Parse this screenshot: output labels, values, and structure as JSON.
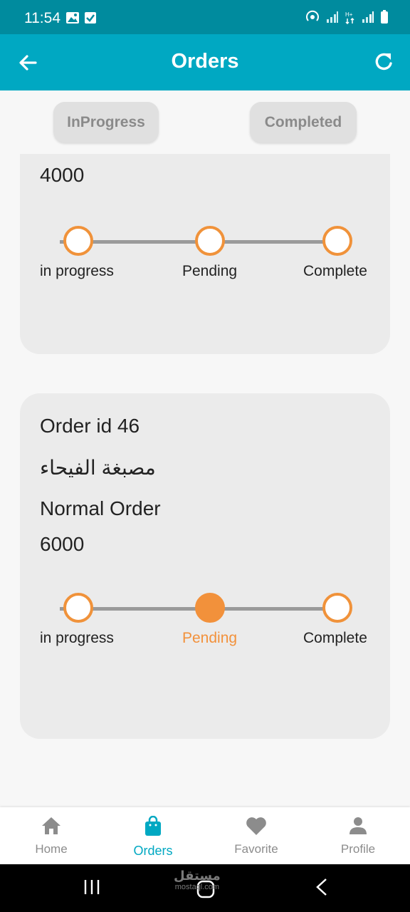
{
  "status": {
    "time": "11:54"
  },
  "appbar": {
    "title": "Orders"
  },
  "tabs": [
    {
      "label": "InProgress"
    },
    {
      "label": "Completed"
    }
  ],
  "orders": [
    {
      "amount": "4000",
      "steps": [
        "in progress",
        "Pending",
        "Complete"
      ],
      "active_step": null
    },
    {
      "order_id": "Order id 46",
      "shop": "مصبغة الفيحاء",
      "type": "Normal Order",
      "amount": "6000",
      "steps": [
        "in progress",
        "Pending",
        "Complete"
      ],
      "active_step": "Pending"
    }
  ],
  "bottom_nav": [
    {
      "label": "Home",
      "icon": "home-icon"
    },
    {
      "label": "Orders",
      "icon": "shopping-bag-icon",
      "active": true
    },
    {
      "label": "Favorite",
      "icon": "heart-icon"
    },
    {
      "label": "Profile",
      "icon": "person-icon"
    }
  ],
  "watermark": {
    "text": "مستقل",
    "sub": "mostaql.com"
  },
  "colors": {
    "primary": "#00a8c2",
    "status_bar": "#008b9e",
    "accent": "#f2913b",
    "card": "#ebebeb"
  }
}
